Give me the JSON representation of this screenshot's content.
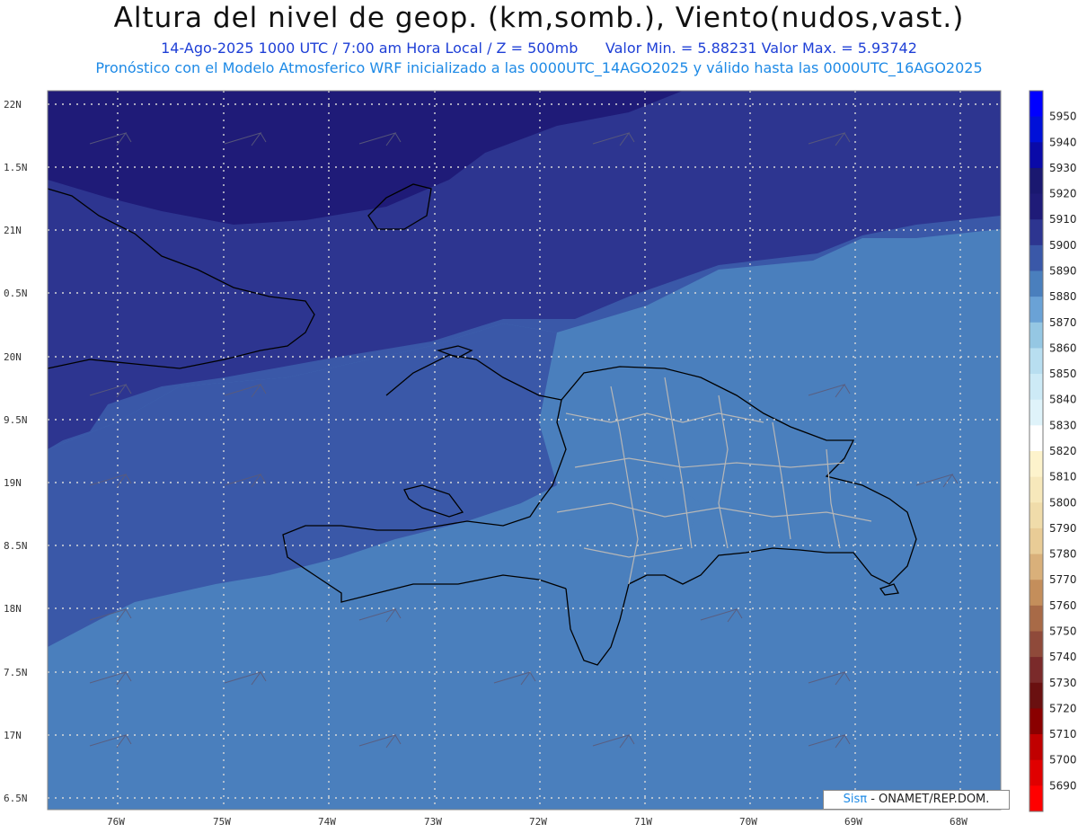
{
  "header": {
    "title": "Altura del nivel de geop. (km,somb.), Viento(nudos,vast.)",
    "subtitle_time": "14-Ago-2025  1000 UTC / 7:00 am Hora Local / Z = 500mb",
    "subtitle_range": "Valor Min. = 5.88231   Valor Max. = 5.93742",
    "model_line": "Pronóstico con el Modelo Atmosferico WRF inicializado a las 0000UTC_14AGO2025 y válido hasta las  0000UTC_16AGO2025"
  },
  "map": {
    "lat_labels": [
      "22N",
      "1.5N",
      "21N",
      "0.5N",
      "20N",
      "9.5N",
      "19N",
      "8.5N",
      "18N",
      "7.5N",
      "17N",
      "6.5N"
    ],
    "lon_labels": [
      "76W",
      "75W",
      "74W",
      "73W",
      "72W",
      "71W",
      "70W",
      "69W",
      "68W"
    ],
    "colors": {
      "z5910": "#1f1b78",
      "z5900": "#2d3590",
      "z5890": "#3a58a8",
      "z5880": "#4a7fbd",
      "land_outline": "#000000",
      "province_lines": "#b7b7b7",
      "grid": "#d8d8d8"
    }
  },
  "colorbar": {
    "levels": [
      "5950",
      "5940",
      "5930",
      "5920",
      "5910",
      "5900",
      "5890",
      "5880",
      "5870",
      "5860",
      "5850",
      "5840",
      "5830",
      "5820",
      "5810",
      "5800",
      "5790",
      "5780",
      "5770",
      "5760",
      "5750",
      "5740",
      "5730",
      "5720",
      "5710",
      "5700",
      "5690"
    ],
    "colors": [
      "#0000ff",
      "#0010d8",
      "#0a0aa8",
      "#1a1870",
      "#1f1b78",
      "#2d3590",
      "#3a58a8",
      "#4a7fbd",
      "#6aa2d6",
      "#95c7e3",
      "#b8def0",
      "#cdeaf6",
      "#dff3fa",
      "#ffffff",
      "#fdf3cc",
      "#f7e8bb",
      "#f0dcaa",
      "#e9cc96",
      "#d9b07a",
      "#c48e5b",
      "#a86a47",
      "#8f4a3a",
      "#7a2a2a",
      "#6a1010",
      "#8a0000",
      "#c00000",
      "#e00000",
      "#ff0000"
    ]
  },
  "credit": {
    "brand": "Sisπ",
    "text": " - ONAMET/REP.DOM."
  }
}
